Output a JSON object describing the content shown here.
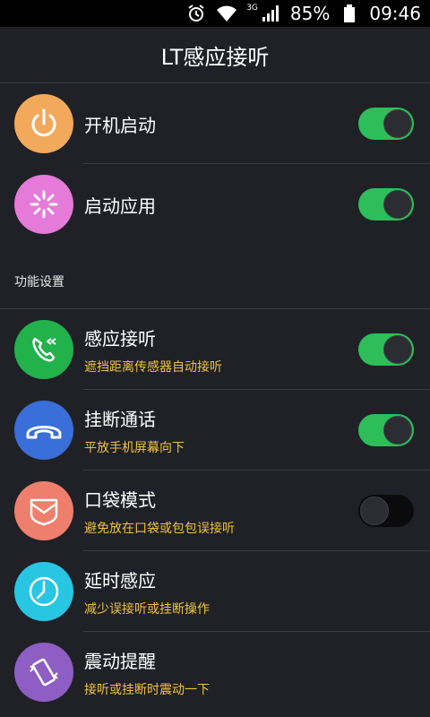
{
  "status_bar": {
    "network": "3G",
    "battery": "85%",
    "time": "09:46"
  },
  "app_title": "LT感应接听",
  "top_items": [
    {
      "title": "开机启动",
      "toggle": "on",
      "icon": "power-icon",
      "color": "#f2a95c"
    },
    {
      "title": "启动应用",
      "toggle": "on",
      "icon": "loading-spinner-icon",
      "color": "#e57ad8"
    }
  ],
  "section_header": "功能设置",
  "settings_items": [
    {
      "title": "感应接听",
      "subtitle": "遮挡距离传感器自动接听",
      "toggle": "on",
      "icon": "phone-incoming-icon",
      "color": "#22b24c"
    },
    {
      "title": "挂断通话",
      "subtitle": "平放手机屏幕向下",
      "toggle": "on",
      "icon": "hang-up-icon",
      "color": "#3a6ed8"
    },
    {
      "title": "口袋模式",
      "subtitle": "避免放在口袋或包包误接听",
      "toggle": "off",
      "icon": "pocket-icon",
      "color": "#ee7f6c"
    },
    {
      "title": "延时感应",
      "subtitle": "减少误接听或挂断操作",
      "icon": "clock-icon",
      "color": "#28c6e3"
    },
    {
      "title": "震动提醒",
      "subtitle": "接听或挂断时震动一下",
      "icon": "vibrate-icon",
      "color": "#8e5ec4"
    }
  ]
}
